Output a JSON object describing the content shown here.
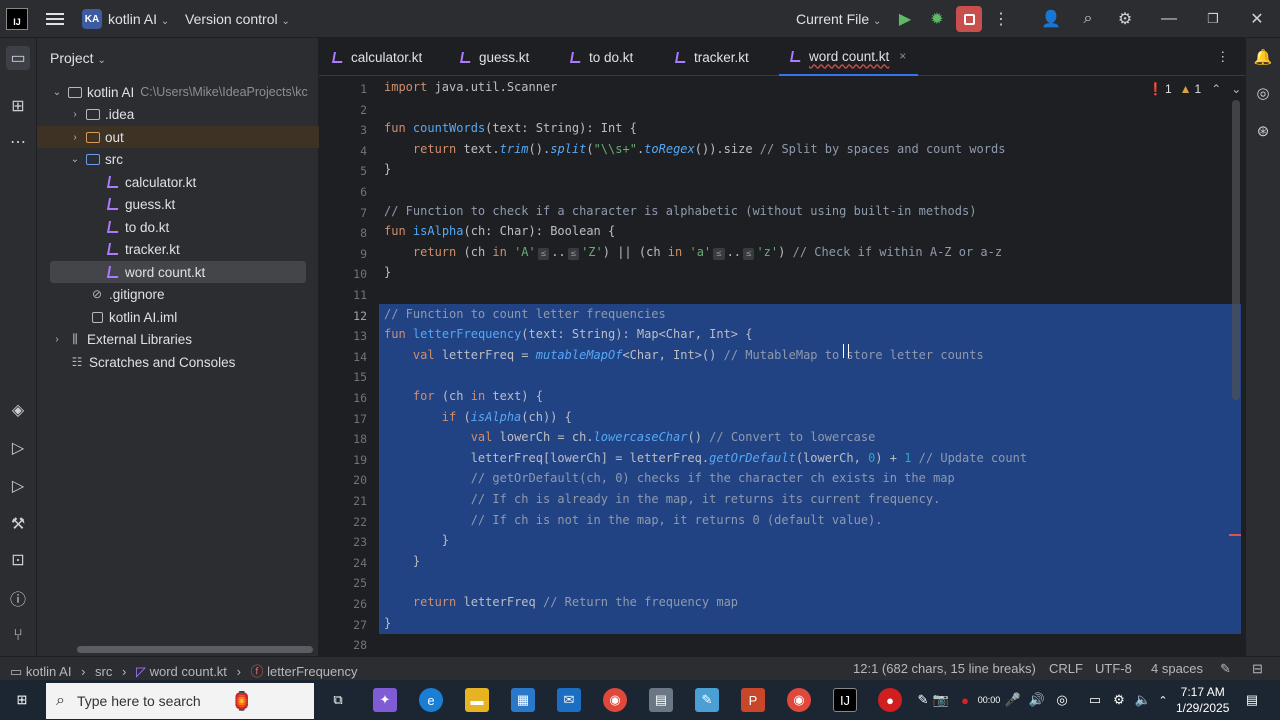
{
  "titlebar": {
    "logo_text": "IJ",
    "project_badge": "KA",
    "project_name": "kotlin AI",
    "vcs_label": "Version control",
    "run_config": "Current File"
  },
  "project_panel": {
    "header": "Project",
    "items": [
      {
        "label": "kotlin AI",
        "path": "C:\\Users\\Mike\\IdeaProjects\\kc",
        "arrow": "⌄"
      },
      {
        "label": ".idea",
        "arrow": "›"
      },
      {
        "label": "out",
        "arrow": "›"
      },
      {
        "label": "src",
        "arrow": "⌄"
      },
      {
        "label": "calculator.kt"
      },
      {
        "label": "guess.kt"
      },
      {
        "label": "to do.kt"
      },
      {
        "label": "tracker.kt"
      },
      {
        "label": "word count.kt"
      },
      {
        "label": ".gitignore"
      },
      {
        "label": "kotlin AI.iml"
      },
      {
        "label": "External Libraries",
        "arrow": "›"
      },
      {
        "label": "Scratches and Consoles"
      }
    ]
  },
  "tabs": [
    {
      "label": "calculator.kt"
    },
    {
      "label": "guess.kt"
    },
    {
      "label": "to do.kt"
    },
    {
      "label": "tracker.kt"
    },
    {
      "label": "word count.kt",
      "close": "×"
    }
  ],
  "inspections": {
    "errors": "1",
    "warnings": "1"
  },
  "code": {
    "line_numbers": [
      "1",
      "2",
      "3",
      "4",
      "5",
      "6",
      "7",
      "8",
      "9",
      "10",
      "11",
      "12",
      "13",
      "14",
      "15",
      "16",
      "17",
      "18",
      "19",
      "20",
      "21",
      "22",
      "23",
      "24",
      "25",
      "26",
      "27",
      "28"
    ],
    "hint_le": "≤"
  },
  "breadcrumb": {
    "project": "kotlin AI",
    "src": "src",
    "file": "word count.kt",
    "symbol": "letterFrequency"
  },
  "status": {
    "position": "12:1 (682 chars, 15 line breaks)",
    "line_sep": "CRLF",
    "encoding": "UTF-8",
    "indent": "4 spaces"
  },
  "taskbar": {
    "search_placeholder": "Type here to search",
    "time": "7:17 AM",
    "date": "1/29/2025",
    "rec_time": "00:00"
  }
}
